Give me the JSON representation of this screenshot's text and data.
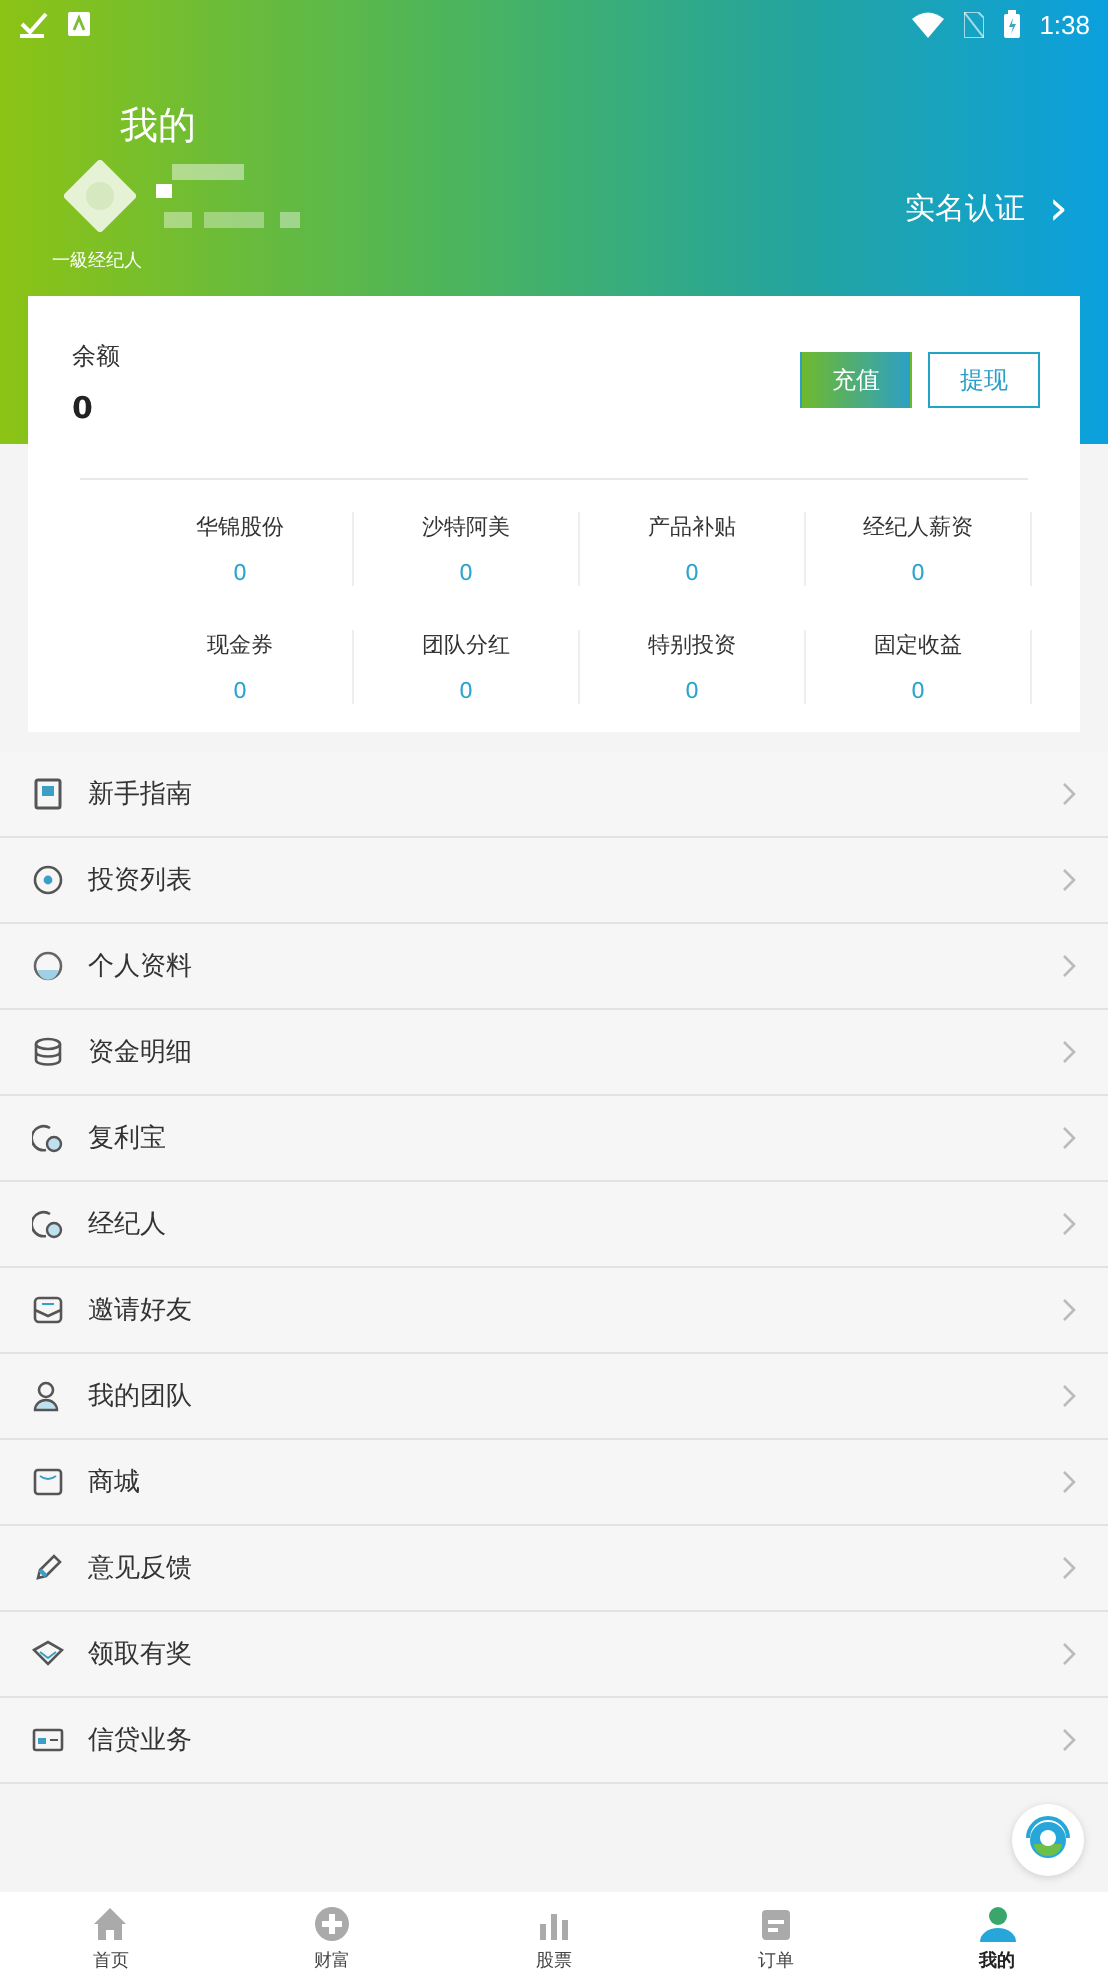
{
  "status_bar": {
    "time": "1:38"
  },
  "header": {
    "title": "我的",
    "level_label": "一級经纪人",
    "verify_link": "实名认证",
    "verify_arrow": "›"
  },
  "balance": {
    "label": "余额",
    "value": "0",
    "buttons": [
      {
        "label": "充值",
        "kind": "primary"
      },
      {
        "label": "提现",
        "kind": "outline"
      }
    ]
  },
  "stats": [
    {
      "label": "华锦股份",
      "value": "0"
    },
    {
      "label": "沙特阿美",
      "value": "0"
    },
    {
      "label": "产品补贴",
      "value": "0"
    },
    {
      "label": "经纪人薪资",
      "value": "0"
    },
    {
      "label": "现金券",
      "value": "0"
    },
    {
      "label": "团队分红",
      "value": "0"
    },
    {
      "label": "特别投资",
      "value": "0"
    },
    {
      "label": "固定收益",
      "value": "0"
    }
  ],
  "menu": [
    {
      "label": "新手指南"
    },
    {
      "label": "投资列表"
    },
    {
      "label": "个人资料"
    },
    {
      "label": "资金明细"
    },
    {
      "label": "复利宝"
    },
    {
      "label": "经纪人"
    },
    {
      "label": "邀请好友"
    },
    {
      "label": "我的团队"
    },
    {
      "label": "商城"
    },
    {
      "label": "意见反馈"
    },
    {
      "label": "领取有奖"
    },
    {
      "label": "信贷业务"
    }
  ],
  "tab_bar": [
    {
      "label": "首页",
      "selected": false
    },
    {
      "label": "财富",
      "selected": false
    },
    {
      "label": "股票",
      "selected": false
    },
    {
      "label": "订单",
      "selected": false
    },
    {
      "label": "我的",
      "selected": true
    }
  ]
}
